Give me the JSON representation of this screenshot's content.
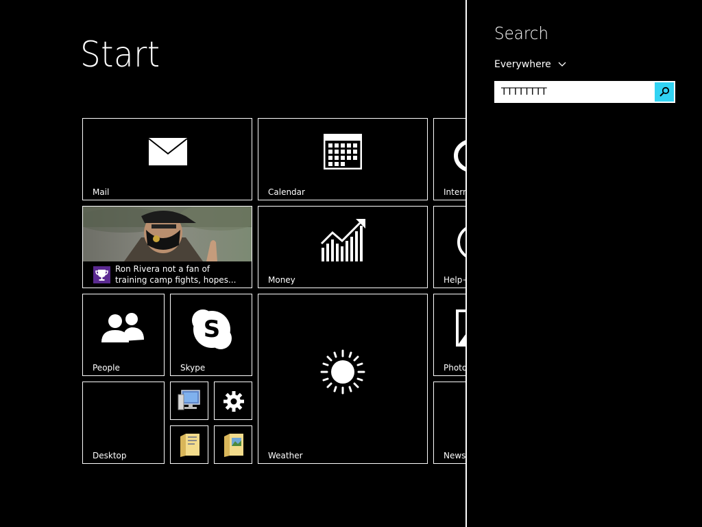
{
  "start": {
    "title": "Start",
    "tiles": {
      "mail": "Mail",
      "calendar": "Calendar",
      "internet_explorer": "Internet Explorer",
      "news_caption_line1": "Ron Rivera not a fan of",
      "news_caption_line2": "training camp fights, hopes...",
      "money": "Money",
      "help_tips": "Help+Tips",
      "people": "People",
      "skype": "Skype",
      "weather": "Weather",
      "photos": "Photos",
      "desktop": "Desktop",
      "news": "News"
    },
    "small_tiles": [
      "this-pc-icon",
      "settings-gear-icon",
      "documents-folder-icon",
      "pictures-folder-icon"
    ]
  },
  "search": {
    "title": "Search",
    "scope": "Everywhere",
    "query": "TTTTTTTT",
    "accent": "#31d3f3"
  },
  "colors": {
    "background": "#000000",
    "tile_border": "#ffffff",
    "news_badge": "#5b2a91"
  }
}
